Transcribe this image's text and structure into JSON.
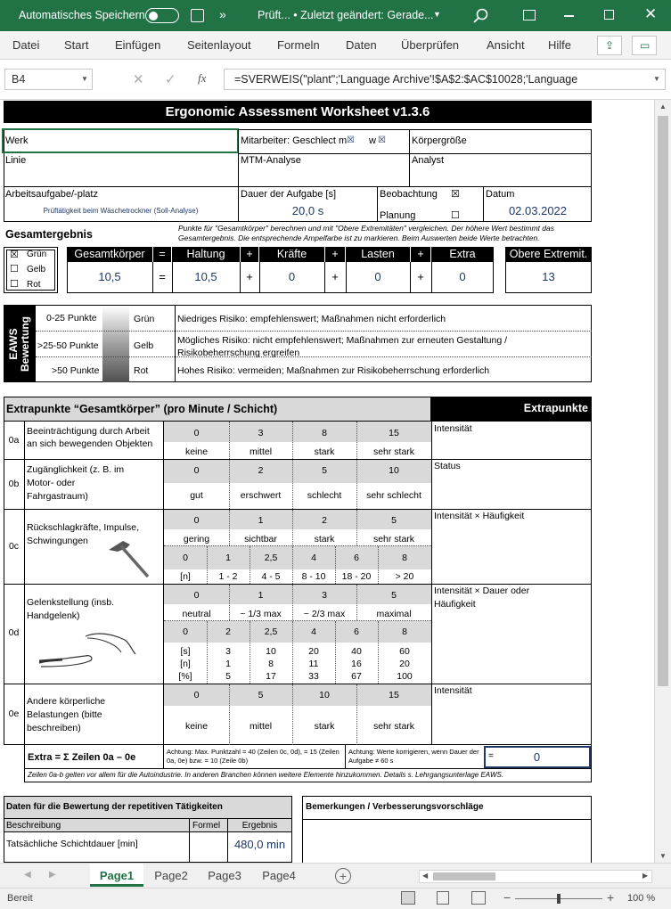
{
  "titlebar": {
    "autosave": "Automatisches Speichern",
    "filename": "Prüft... • Zuletzt geändert: Gerade...",
    "more": "»"
  },
  "ribbon": {
    "items": [
      "Datei",
      "Start",
      "Einfügen",
      "Seitenlayout",
      "Formeln",
      "Daten",
      "Überprüfen",
      "Ansicht",
      "Hilfe"
    ]
  },
  "formula": {
    "cell": "B4",
    "fx": "fx",
    "content": "=SVERWEIS(\"plant\";'Language Archive'!$A$2:$AC$10028;'Language"
  },
  "sheet": {
    "title": "Ergonomic Assessment Worksheet  v1.3.6",
    "werk": "Werk",
    "mitarbeiter": "Mitarbeiter: Geschlect m",
    "w": "w",
    "groesse": "Körpergröße",
    "linie": "Linie",
    "mtm": "MTM-Analyse",
    "analyst": "Analyst",
    "arbeitsaufgabe": "Arbeitsaufgabe/-platz",
    "task_value": "Prüftätigkeit beim Wäschetrockner (Soll-Analyse)",
    "dauer": "Dauer der Aufgabe [s]",
    "dauer_val": "20,0 s",
    "beobachtung": "Beobachtung",
    "planung": "Planung",
    "datum": "Datum",
    "datum_val": "02.03.2022",
    "gesamtergebnis": "Gesamtergebnis",
    "note1": "Punkte für \"Gesamtkörper\" berechnen und mit \"Obere Extremitäten\" vergleichen. Der höhere Wert bestimmt das Gesamtergebnis. Die entsprechende Ampelfarbe ist zu markieren. Beim Auswerten beide Werte betrachten.",
    "ampel": {
      "gruen": "Grün",
      "gelb": "Gelb",
      "rot": "Rot"
    },
    "heads": {
      "gesamt": "Gesamtkörper",
      "eq": "=",
      "haltung": "Haltung",
      "plus": "+",
      "kraefte": "Kräfte",
      "lasten": "Lasten",
      "extra": "Extra",
      "obere": "Obere Extremit."
    },
    "vals": {
      "gesamt": "10,5",
      "haltung": "10,5",
      "kraefte": "0",
      "lasten": "0",
      "extra": "0",
      "obere": "13"
    },
    "eaws": "EAWS",
    "bewertung": "Bewertung",
    "risk": [
      {
        "range": "0-25 Punkte",
        "color": "Grün",
        "text": "Niedriges Risiko: empfehlenswert; Maßnahmen nicht erforderlich"
      },
      {
        "range": ">25-50 Punkte",
        "color": "Gelb",
        "text": "Mögliches Risiko: nicht empfehlenswert; Maßnahmen zur erneuten Gestaltung / Risikobeherrschung ergreifen"
      },
      {
        "range": ">50 Punkte",
        "color": "Rot",
        "text": "Hohes Risiko: vermeiden; Maßnahmen zur Risikobeherrschung erforderlich"
      }
    ],
    "extra_title": "Extrapunkte “Gesamtkörper” (pro Minute / Schicht)",
    "extrapunkte": "Extrapunkte",
    "rows": {
      "r0a": {
        "id": "0a",
        "label": "Beeinträchtigung durch Arbeit an sich bewegenden Objekten",
        "nums": [
          "0",
          "3",
          "8",
          "15"
        ],
        "words": [
          "keine",
          "mittel",
          "stark",
          "sehr stark"
        ],
        "right": "Intensität"
      },
      "r0b": {
        "id": "0b",
        "label": "Zugänglichkeit (z. B. im Motor- oder Fahrgastraum)",
        "nums": [
          "0",
          "2",
          "5",
          "10"
        ],
        "words": [
          "gut",
          "erschwert",
          "schlecht",
          "sehr schlecht"
        ],
        "right": "Status"
      },
      "r0c": {
        "id": "0c",
        "label": "Rückschlagkräfte, Impulse, Schwingungen",
        "nums": [
          "0",
          "1",
          "2",
          "5"
        ],
        "words": [
          "gering",
          "sichtbar",
          "stark",
          "sehr stark"
        ],
        "nums2": [
          "0",
          "1",
          "2,5",
          "4",
          "6",
          "8"
        ],
        "freq": [
          "[n]",
          "1 - 2",
          "4 - 5",
          "8 - 10",
          "18 - 20",
          "> 20"
        ],
        "right": "Intensität × Häufigkeit"
      },
      "r0d": {
        "id": "0d",
        "label": "Gelenkstellung (insb. Handgelenk)",
        "nums": [
          "0",
          "1",
          "3",
          "5"
        ],
        "words": [
          "neutral",
          "~ 1/3 max",
          "~ 2/3 max",
          "maximal"
        ],
        "nums2": [
          "0",
          "2",
          "2,5",
          "4",
          "6",
          "8"
        ],
        "s": [
          "[s]",
          "3",
          "10",
          "20",
          "40",
          "60"
        ],
        "n": [
          "[n]",
          "1",
          "8",
          "11",
          "16",
          "20"
        ],
        "p": [
          "[%]",
          "5",
          "17",
          "33",
          "67",
          "100"
        ],
        "right": "Intensität × Dauer oder Häufigkeit"
      },
      "r0e": {
        "id": "0e",
        "label": "Andere körperliche Belastungen (bitte beschreiben)",
        "nums": [
          "0",
          "5",
          "10",
          "15"
        ],
        "words": [
          "keine",
          "mittel",
          "stark",
          "sehr stark"
        ],
        "right": "Intensität"
      }
    },
    "extra_sum": "Extra = Σ Zeilen 0a – 0e",
    "achtung1": "Achtung: Max. Punktzahl = 40 (Zeilen 0c, 0d), = 15 (Zeilen 0a, 0e) bzw. = 10 (Zeile 0b)",
    "achtung2": "Achtung: Werte korrigieren, wenn Dauer der Aufgabe ≠ 60 s",
    "eq_sign": "=",
    "extra_total": "0",
    "footnote": "Zeilen 0a-b gelten vor allem für die Autoindustrie. In anderen Branchen können weitere Elemente hinzukommen. Details s. Lehrgangsunterlage EAWS.",
    "daten_title": "Daten für die Bewertung der repetitiven Tätigkeiten",
    "bemerkungen": "Bemerkungen / Verbesserungsvorschläge",
    "col_beschreibung": "Beschreibung",
    "col_formel": "Formel",
    "col_ergebnis": "Ergebnis",
    "schicht": "Tatsächliche Schichtdauer [min]",
    "schicht_val": "480,0 min"
  },
  "tabs": [
    "Page1",
    "Page2",
    "Page3",
    "Page4"
  ],
  "status": {
    "ready": "Bereit",
    "zoom": "100 %"
  },
  "colors": {
    "excel_green": "#217346",
    "value_blue": "#1f3864"
  }
}
